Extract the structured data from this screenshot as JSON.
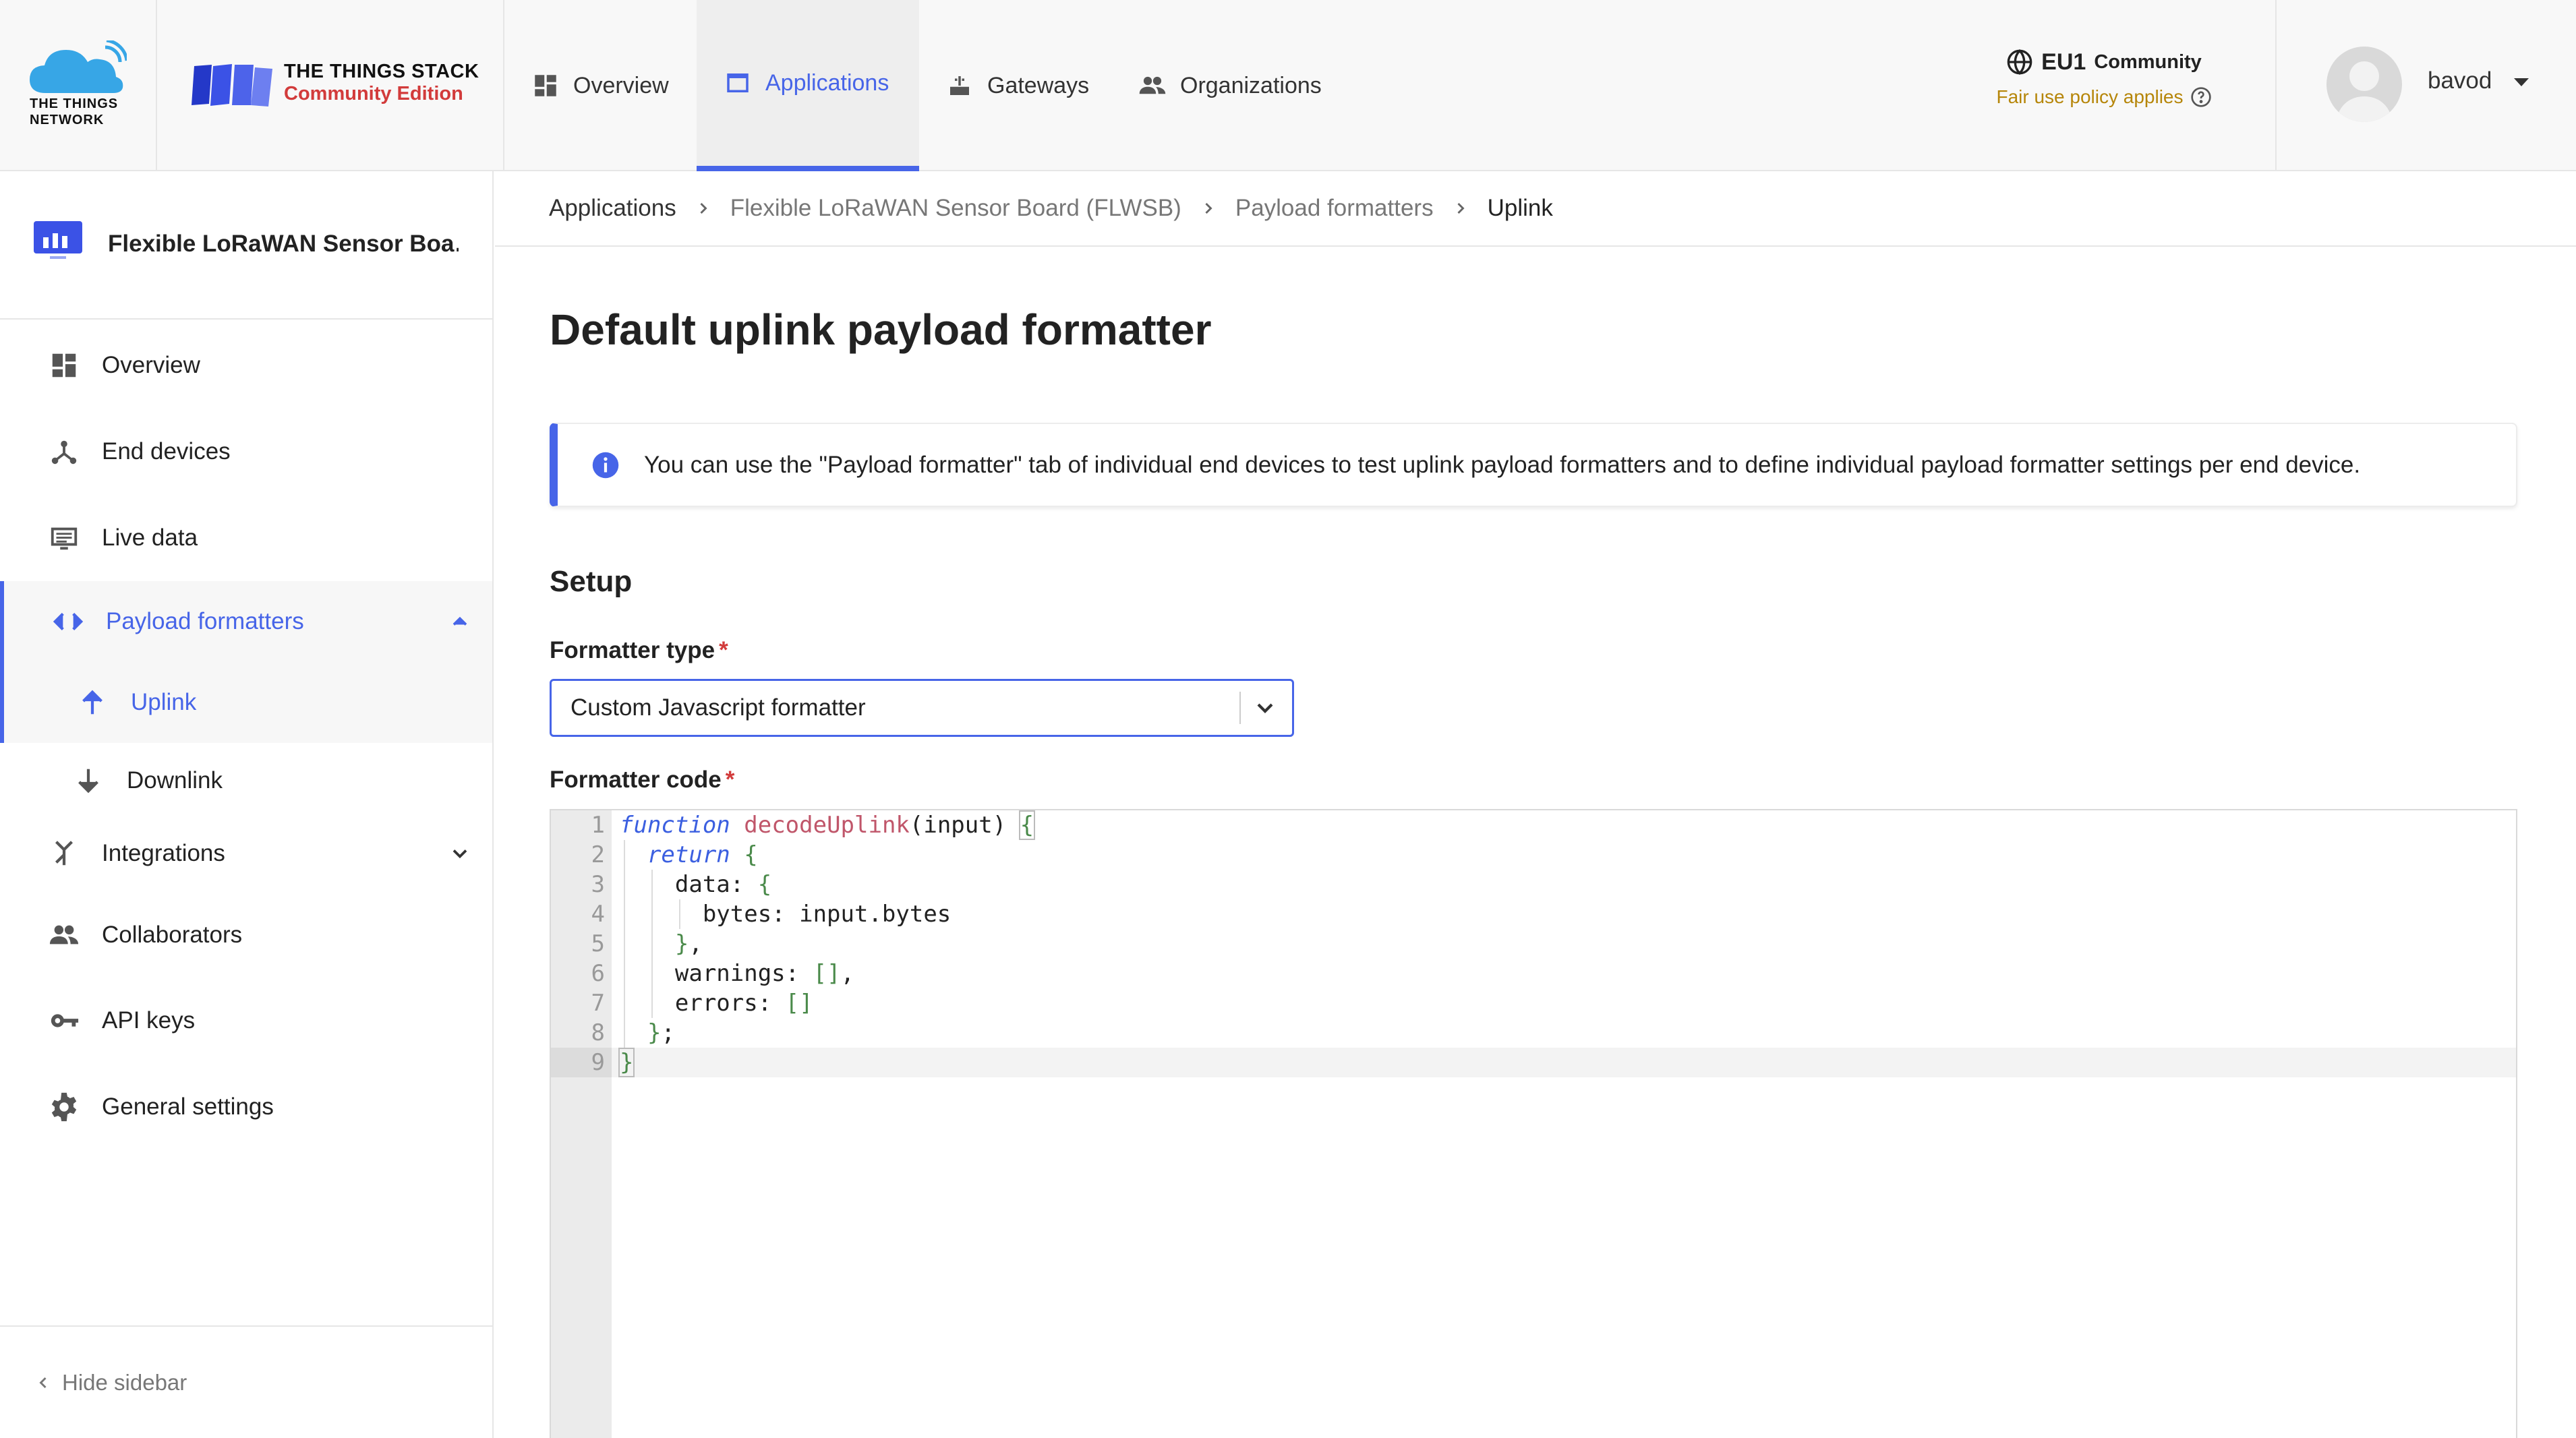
{
  "header": {
    "ttn_logo_text_1": "THE THINGS",
    "ttn_logo_text_2": "NETWORK",
    "tts_title": "THE THINGS STACK",
    "tts_subtitle": "Community Edition",
    "nav": [
      {
        "label": "Overview",
        "icon": "dashboard-icon"
      },
      {
        "label": "Applications",
        "icon": "application-icon"
      },
      {
        "label": "Gateways",
        "icon": "gateway-icon"
      },
      {
        "label": "Organizations",
        "icon": "organization-icon"
      }
    ],
    "active_nav": "Applications",
    "cluster_label": "EU1",
    "cluster_suffix": "Community",
    "fair_use": "Fair use policy applies",
    "username": "bavod"
  },
  "sidebar": {
    "app_name": "Flexible LoRaWAN Sensor Boa…",
    "items": [
      {
        "label": "Overview",
        "icon": "dashboard-icon"
      },
      {
        "label": "End devices",
        "icon": "devices-icon"
      },
      {
        "label": "Live data",
        "icon": "live-data-icon"
      },
      {
        "label": "Payload formatters",
        "icon": "code-icon",
        "expanded": true
      },
      {
        "label": "Uplink",
        "icon": "arrow-up-icon",
        "active": true
      },
      {
        "label": "Downlink",
        "icon": "arrow-down-icon"
      },
      {
        "label": "Integrations",
        "icon": "integrations-icon",
        "expanded": false
      },
      {
        "label": "Collaborators",
        "icon": "people-icon"
      },
      {
        "label": "API keys",
        "icon": "key-icon"
      },
      {
        "label": "General settings",
        "icon": "gear-icon"
      }
    ],
    "hide_label": "Hide sidebar"
  },
  "breadcrumb": [
    "Applications",
    "Flexible LoRaWAN Sensor Board (FLWSB)",
    "Payload formatters",
    "Uplink"
  ],
  "main": {
    "title": "Default uplink payload formatter",
    "notice": "You can use the \"Payload formatter\" tab of individual end devices to test uplink payload formatters and to define individual payload formatter settings per end device.",
    "setup_title": "Setup",
    "formatter_type_label": "Formatter type",
    "formatter_type_value": "Custom Javascript formatter",
    "formatter_code_label": "Formatter code",
    "required_mark": "*",
    "line_numbers": [
      "1",
      "2",
      "3",
      "4",
      "5",
      "6",
      "7",
      "8",
      "9"
    ]
  },
  "colors": {
    "accent": "#4765e8",
    "required": "#d23b3b",
    "fair_use": "#b6860a"
  }
}
